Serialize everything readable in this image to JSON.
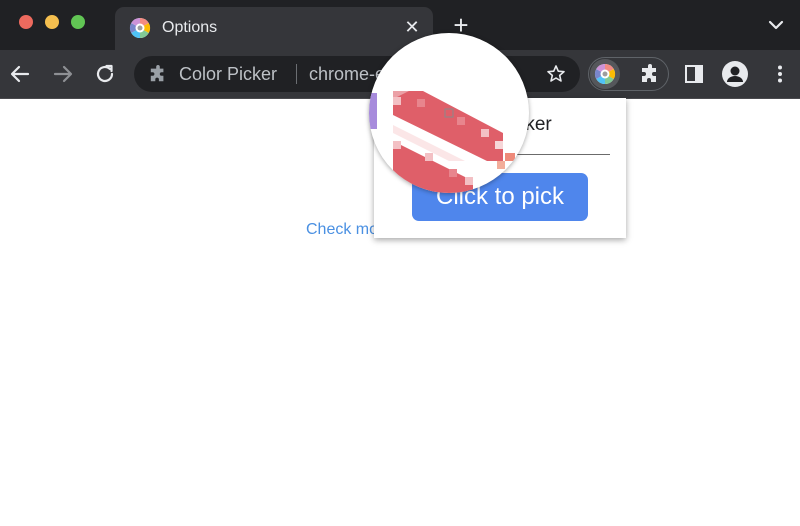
{
  "window": {
    "traffic_lights": [
      "close",
      "minimize",
      "zoom"
    ]
  },
  "tab": {
    "title": "Options",
    "favicon": "color-wheel-icon",
    "close_glyph": "✕"
  },
  "tabstrip": {
    "new_tab_glyph": "+",
    "tab_search_icon": "chevron-down-icon"
  },
  "toolbar": {
    "back_icon": "arrow-left-icon",
    "forward_icon": "arrow-right-icon",
    "reload_icon": "reload-icon",
    "omnibox": {
      "extension_name": "Color Picker",
      "url": "chrome-extension://"
    },
    "bookmark_icon": "star-icon",
    "menu_icon": "kebab-icon"
  },
  "page": {
    "link_text": "Check more"
  },
  "popup": {
    "title": "Color Picker",
    "button_label": "Click to pick"
  },
  "colors": {
    "tabstrip_bg": "#202124",
    "toolbar_bg": "#35363a",
    "button_blue": "#4f86ec",
    "link_blue": "#4a90e2",
    "loupe_red": "#e0606a"
  }
}
